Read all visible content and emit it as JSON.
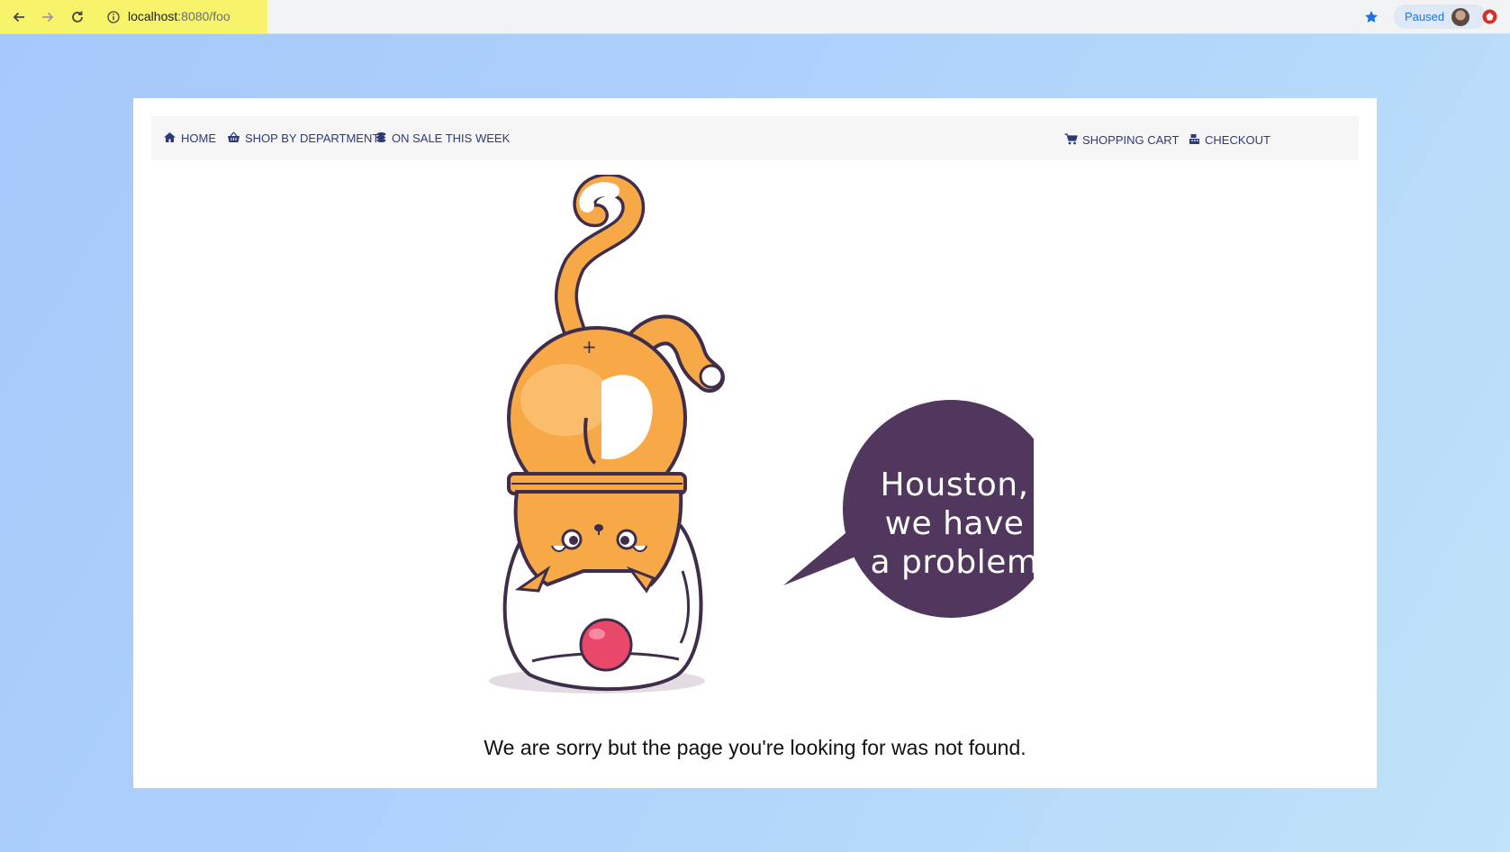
{
  "browser": {
    "url_host": "localhost",
    "url_rest": ":8080/foo",
    "profile_status": "Paused",
    "icons": [
      "back-icon",
      "forward-icon",
      "reload-icon",
      "info-icon",
      "bookmark-star-icon",
      "avatar",
      "extension-icon"
    ],
    "colors": {
      "highlight": "#f7f36a",
      "accent": "#1a73e8"
    }
  },
  "nav": {
    "left": [
      {
        "label": "HOME",
        "icon": "home-icon"
      },
      {
        "label": "SHOP BY DEPARTMENT",
        "icon": "basket-icon"
      },
      {
        "label": "ON SALE THIS WEEK",
        "icon": "coins-icon"
      }
    ],
    "right": [
      {
        "label": "SHOPPING CART",
        "icon": "cart-icon"
      },
      {
        "label": "CHECKOUT",
        "icon": "cash-register-icon"
      }
    ],
    "text_color": "#2d3a78"
  },
  "illustration": {
    "bubble_lines": [
      "Houston,",
      "we have",
      "a problem"
    ],
    "subject": "cat-in-jar-icon",
    "colors": {
      "cat": "#f7a948",
      "bubble": "#51375d",
      "ball": "#e8496a",
      "outline": "#3f2d4a"
    }
  },
  "message": "We are sorry but the page you're looking for was not found."
}
